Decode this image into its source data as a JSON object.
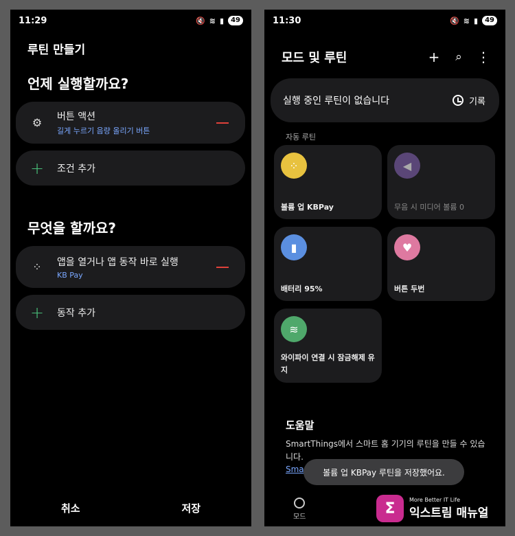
{
  "left": {
    "status": {
      "time": "11:29",
      "battery": "49"
    },
    "title": "루틴 만들기",
    "when_heading": "언제 실행할까요?",
    "trigger": {
      "title": "버튼 액션",
      "subtitle": "길게 누르기 음량 올리기 버튼"
    },
    "add_condition": "조건 추가",
    "what_heading": "무엇을 할까요?",
    "action": {
      "title": "앱을 열거나 앱 동작 바로 실행",
      "subtitle": "KB Pay"
    },
    "add_action": "동작 추가",
    "cancel": "취소",
    "save": "저장"
  },
  "right": {
    "status": {
      "time": "11:30",
      "battery": "49"
    },
    "title": "모드 및 루틴",
    "banner_text": "실행 중인 루틴이 없습니다",
    "history": "기록",
    "auto_label": "자동 루틴",
    "tiles": [
      {
        "label": "볼륨 업 KBPay",
        "color": "#e8c23f",
        "icon": "apps-icon"
      },
      {
        "label": "무음 시 미디어 볼륨 0",
        "color": "#5a4677",
        "icon": "speaker-icon"
      },
      {
        "label": "배터리 95%",
        "color": "#5b8fe0",
        "icon": "battery-icon"
      },
      {
        "label": "버튼 두번",
        "color": "#de79a0",
        "icon": "heart-icon"
      },
      {
        "label": "와이파이 연결 시 잠금해제 유지",
        "color": "#4fa86b",
        "icon": "wifi-icon"
      }
    ],
    "help_title": "도움말",
    "help_text": "SmartThings에서 스마트 홈 기기의 루틴을 만들 수 있습니다.",
    "help_link": "Smar",
    "toast": "볼륨 업 KBPay 루틴을 저장했어요.",
    "nav_label": "모드"
  },
  "watermark": {
    "tagline": "More Better IT Life",
    "name": "익스트림 매뉴얼"
  }
}
